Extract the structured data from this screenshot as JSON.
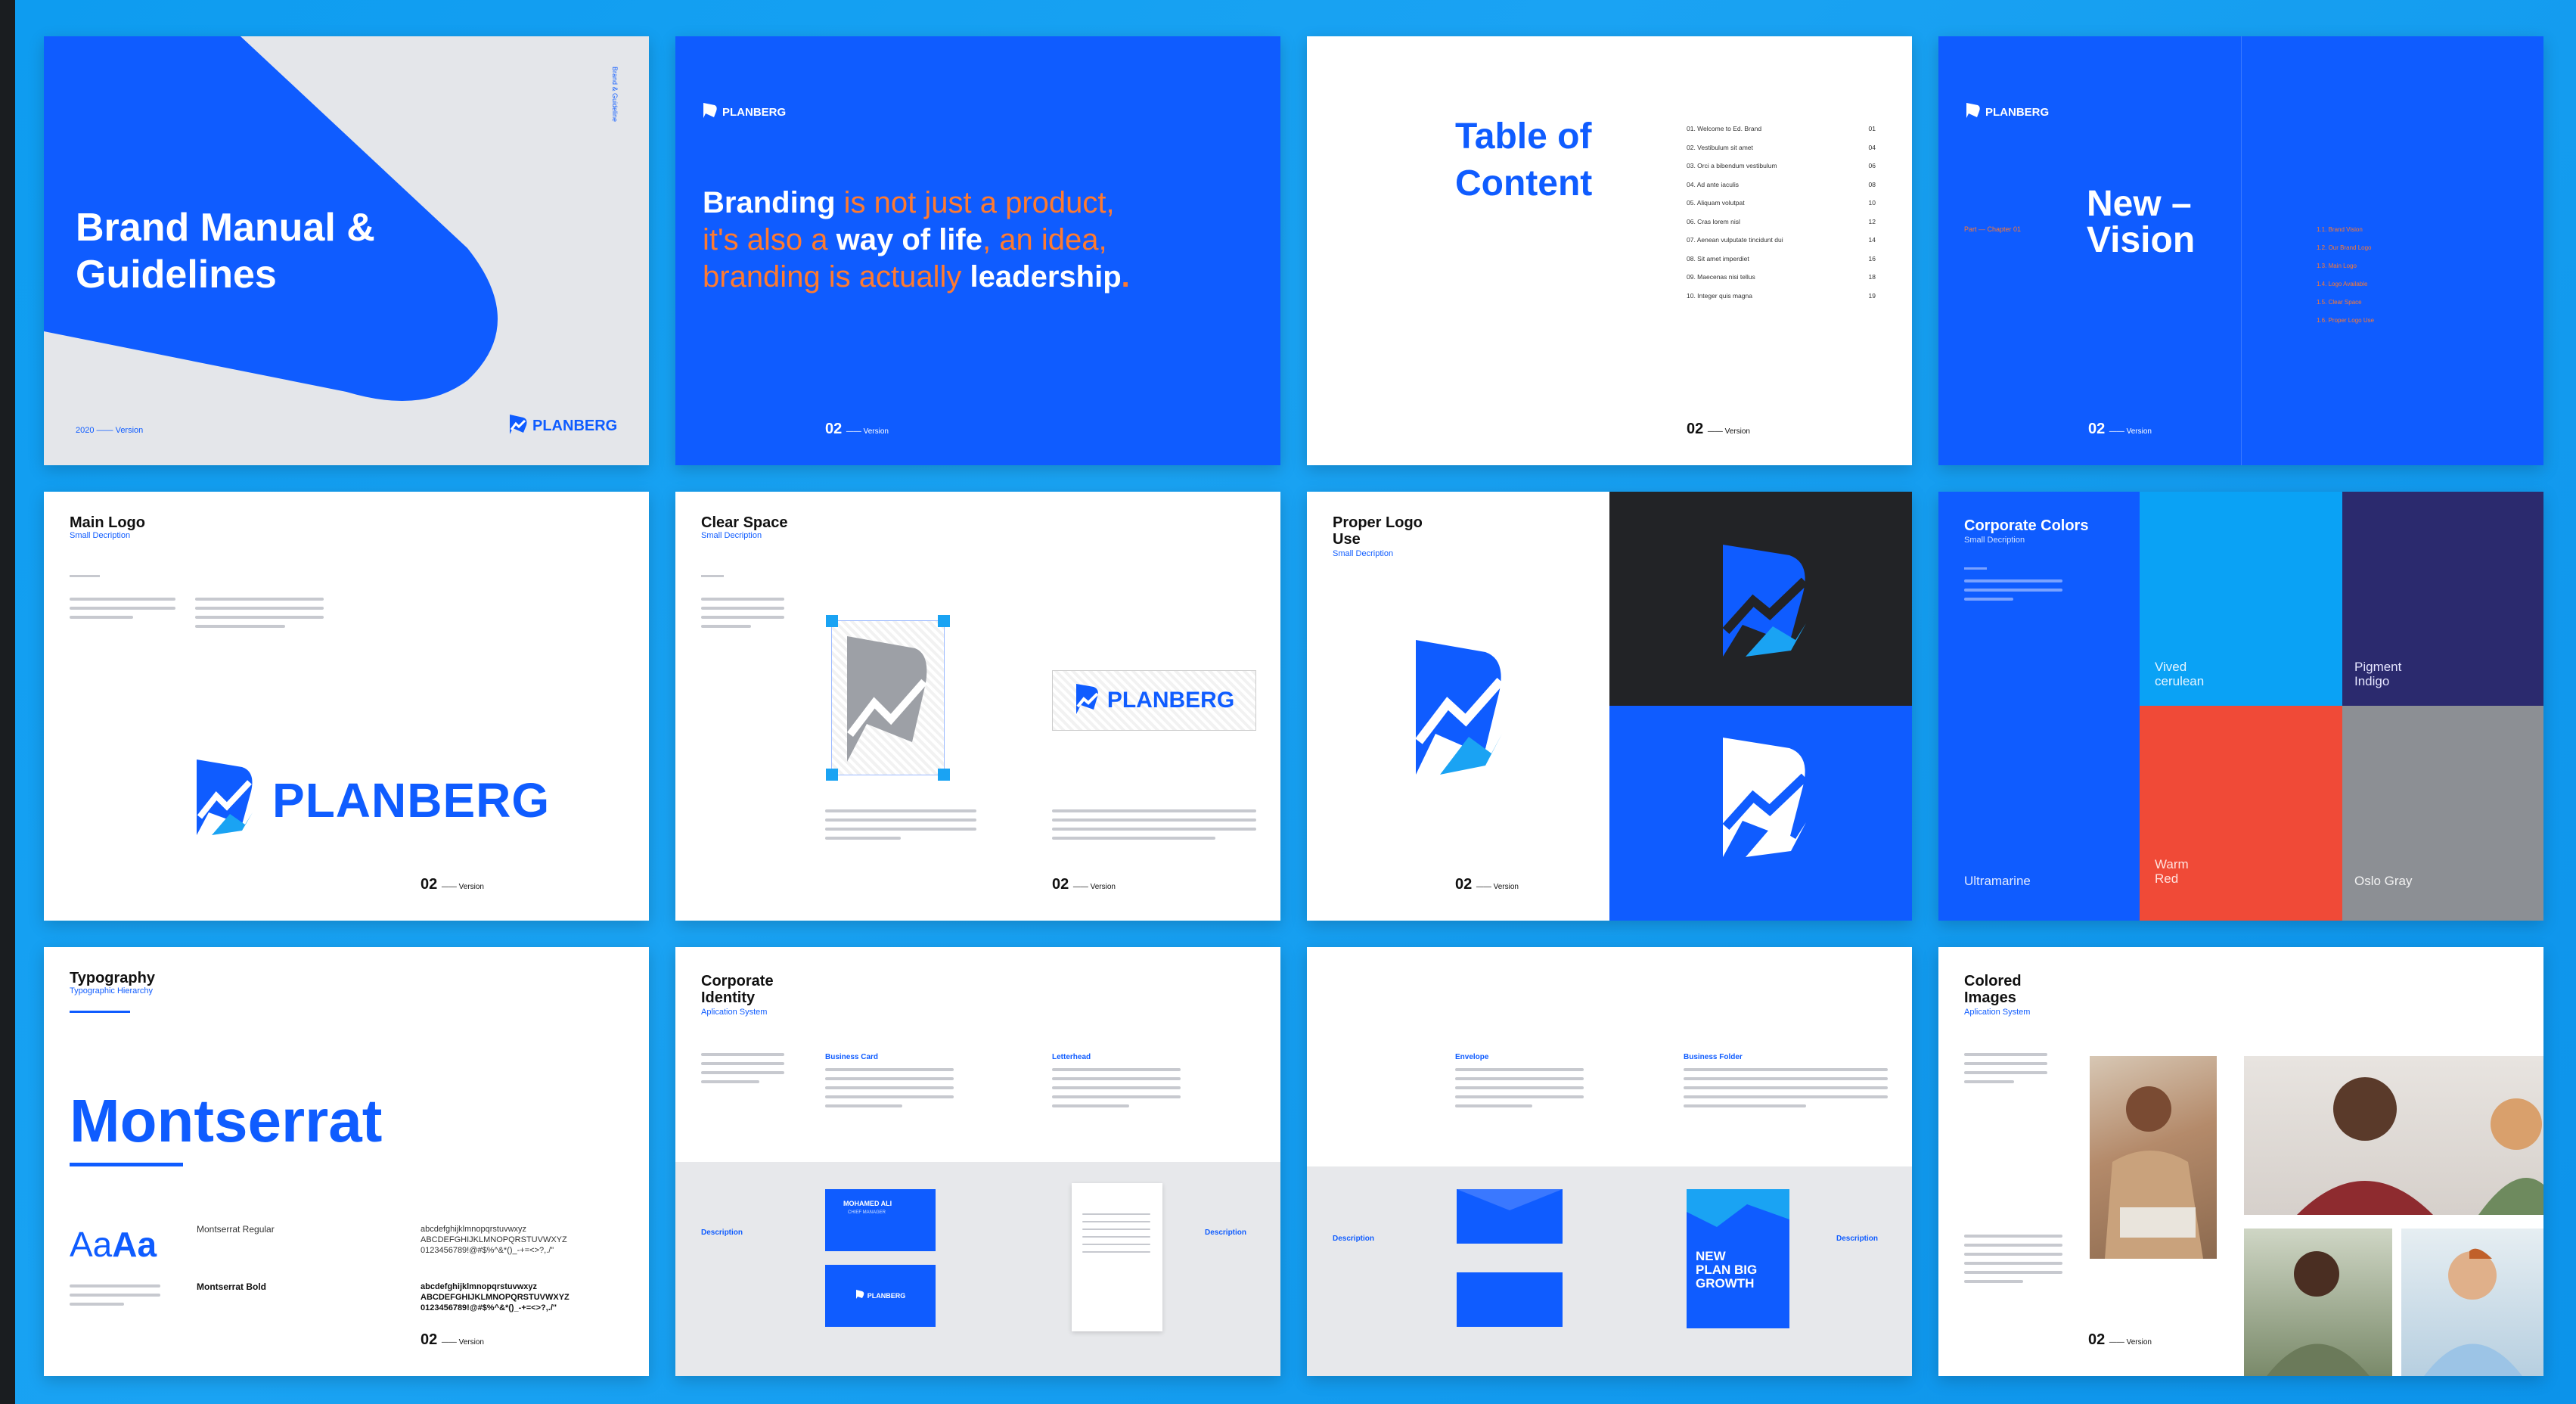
{
  "slides": {
    "s1": {
      "title": "Brand Manual & Guidelines",
      "year_version": "2020 —— Version",
      "logo": "PLANBERG",
      "side_text": "Brand & Guideline"
    },
    "s2": {
      "logo": "PLANBERG",
      "q1a": "Branding",
      "q1b": " is not just a product,",
      "q2a": "it's also a ",
      "q2b": "way of life",
      "q2c": ", an idea,",
      "q3a": "branding is actually ",
      "q3b": "leadership",
      "q3c": ".",
      "footer": "02",
      "footer_ver": "—— Version"
    },
    "s3": {
      "title_line1": "Table of",
      "title_line2": "Content",
      "footer": "02",
      "footer_ver": "—— Version",
      "toc": [
        "01. Welcome to Ed. Brand",
        "02. Vestibulum sit amet",
        "03. Orci a bibendum vestibulum",
        "04. Ad ante iaculis",
        "05. Aliquam volutpat",
        "06. Cras lorem nisl",
        "07. Aenean vulputate tincidunt dui",
        "08. Sit amet imperdiet",
        "09. Maecenas nisi tellus",
        "10. Integer quis magna"
      ],
      "toc_pages": [
        "01",
        "04",
        "06",
        "08",
        "10",
        "12",
        "14",
        "16",
        "18",
        "19"
      ]
    },
    "s4": {
      "logo": "PLANBERG",
      "title_line1": "New –",
      "title_line2": "Vision",
      "kicker": "Part — Chapter 01",
      "footer": "02",
      "footer_ver": "—— Version",
      "list": [
        "1.1. Brand Vision",
        "1.2. Our Brand Logo",
        "1.3. Main Logo",
        "1.4. Logo Available",
        "1.5. Clear Space",
        "1.6. Proper Logo Use"
      ]
    },
    "s5": {
      "title": "Main Logo",
      "sub": "Small Decription",
      "logo": "PLANBERG",
      "footer": "02",
      "footer_ver": "—— Version"
    },
    "s6": {
      "title": "Clear Space",
      "sub": "Small Decription",
      "logo": "PLANBERG",
      "footer": "02",
      "footer_ver": "—— Version"
    },
    "s7": {
      "title_line1": "Proper Logo",
      "title_line2": "Use",
      "sub": "Small Decription",
      "footer": "02",
      "footer_ver": "—— Version"
    },
    "s8": {
      "title": "Corporate Colors",
      "sub": "Small Decription",
      "swatches": [
        {
          "name": "Vived cerulean",
          "color": "#0aa2f5"
        },
        {
          "name": "Pigment Indigo",
          "color": "#2b2a6e"
        },
        {
          "name": "Ultramarine",
          "color": "#0f5cff"
        },
        {
          "name": "Warm Red",
          "color": "#f04a37"
        },
        {
          "name": "Oslo Gray",
          "color": "#8c8f94"
        }
      ]
    },
    "s9": {
      "title": "Typography",
      "sub": "Typographic Hierarchy",
      "font": "Montserrat",
      "sample": "Aa",
      "sample2": "Aa",
      "regular": "Montserrat Regular",
      "bold": "Montserrat Bold",
      "alpha1": "abcdefghijklmnopqrstuvwxyz",
      "alpha2": "ABCDEFGHIJKLMNOPQRSTUVWXYZ",
      "alpha3": "0123456789!@#$%^&*()_-+=<>?,./\"",
      "footer": "02",
      "footer_ver": "—— Version"
    },
    "s10": {
      "title_line1": "Corporate",
      "title_line2": "Identity",
      "sub": "Aplication System",
      "h1": "Business Card",
      "h2": "Letterhead",
      "desc": "Description",
      "card_name": "MOHAMED ALI",
      "card_role": "CHIEF MANAGER",
      "logo": "PLANBERG"
    },
    "s11": {
      "h1": "Envelope",
      "h2": "Business Folder",
      "desc": "Description",
      "folder_text": "NEW PLAN BIG GROWTH"
    },
    "s12": {
      "title_line1": "Colored",
      "title_line2": "Images",
      "sub": "Aplication System",
      "footer": "02",
      "footer_ver": "—— Version"
    }
  }
}
